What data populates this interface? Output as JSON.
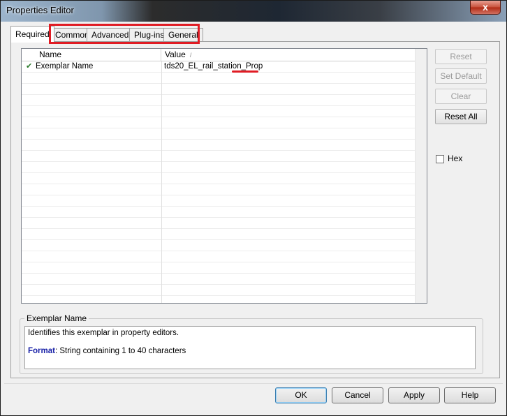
{
  "window": {
    "title": "Properties Editor",
    "close_glyph": "x"
  },
  "tabs": [
    {
      "label": "Required",
      "active": true
    },
    {
      "label": "Common",
      "active": false
    },
    {
      "label": "Advanced",
      "active": false
    },
    {
      "label": "Plug-ins",
      "active": false
    },
    {
      "label": "General",
      "active": false
    }
  ],
  "grid": {
    "columns": [
      "Name",
      "Value"
    ],
    "rows": [
      {
        "check": "✔",
        "name": "Exemplar Name",
        "value_prefix": "tds20_EL_rail_station",
        "value_suffix": "_Prop"
      }
    ]
  },
  "side_buttons": {
    "reset": "Reset",
    "set_default": "Set Default",
    "clear": "Clear",
    "reset_all": "Reset All"
  },
  "hex": {
    "label": "Hex",
    "checked": false
  },
  "description": {
    "group_title": "Exemplar Name",
    "line1": "Identifies this exemplar in property editors.",
    "format_label": "Format",
    "format_text": ": String containing 1 to 40 characters"
  },
  "dialog_buttons": {
    "ok": "OK",
    "cancel": "Cancel",
    "apply": "Apply",
    "help": "Help"
  },
  "colors": {
    "annotation_red": "#e01c24",
    "format_blue": "#1a22a8",
    "check_green": "#2a7a2a"
  }
}
